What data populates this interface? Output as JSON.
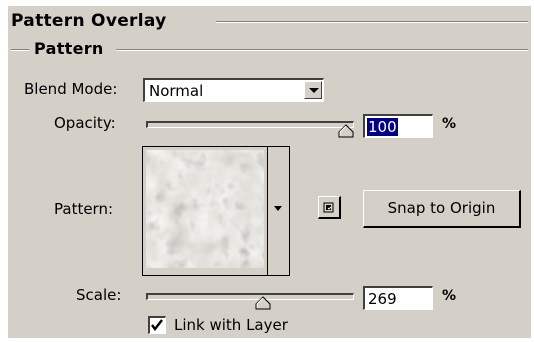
{
  "section": {
    "title": "Pattern Overlay",
    "group_title": "Pattern"
  },
  "blend_mode": {
    "label": "Blend Mode:",
    "value": "Normal"
  },
  "opacity": {
    "label": "Opacity:",
    "value": "100",
    "unit": "%",
    "level": 100
  },
  "pattern": {
    "label": "Pattern:",
    "snap_button": "Snap to Origin"
  },
  "scale": {
    "label": "Scale:",
    "value": "269",
    "unit": "%"
  },
  "link": {
    "label": "Link with Layer",
    "checked": true
  },
  "icons": [
    "dropdown-arrow-icon",
    "pattern-menu-arrow-icon",
    "new-preset-icon",
    "slider-thumb-icon",
    "checkmark-icon"
  ]
}
